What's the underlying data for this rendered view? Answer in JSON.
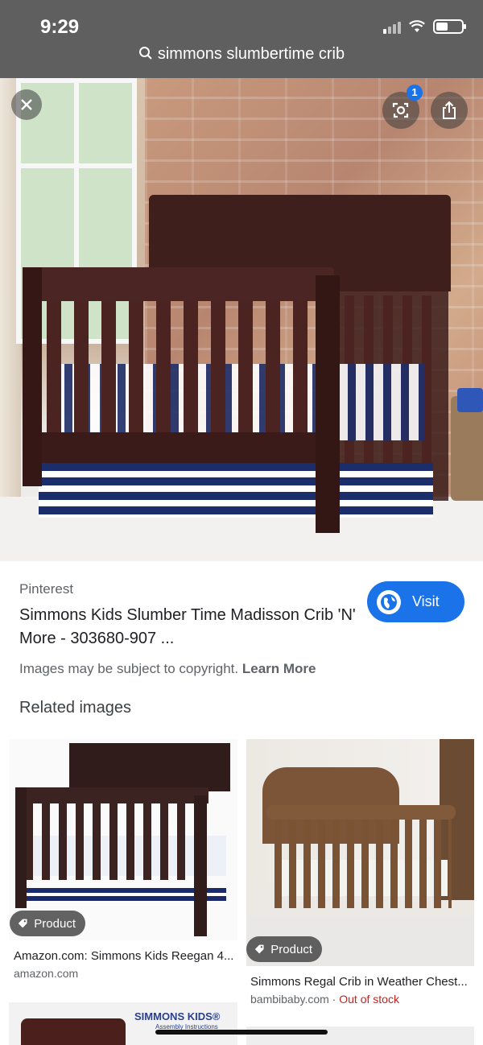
{
  "status_bar": {
    "time": "9:29"
  },
  "search": {
    "query": "simmons slumbertime crib"
  },
  "viewer": {
    "close_icon": "close-icon",
    "lens_badge_count": "1",
    "lens_icon": "google-lens-icon",
    "share_icon": "share-icon"
  },
  "result": {
    "source": "Pinterest",
    "title": "Simmons Kids Slumber Time Madisson Crib 'N' More - 303680-907 ...",
    "visit_label": "Visit",
    "copyright_text": "Images may be subject to copyright.",
    "learn_more_label": "Learn More"
  },
  "related": {
    "heading": "Related images",
    "items": [
      {
        "badge": "Product",
        "title": "Amazon.com: Simmons Kids Reegan 4...",
        "source": "amazon.com"
      },
      {
        "badge": "Product",
        "title": "Simmons Regal Crib in Weather Chest...",
        "source": "bambibaby.com",
        "separator": " · ",
        "stock": "Out of stock"
      },
      {
        "logo_text": "SIMMONS KIDS®",
        "logo_sub": "Assembly Instructions"
      }
    ]
  },
  "colors": {
    "accent": "#1a73e8",
    "out_of_stock": "#c5221f",
    "top_bar": "#5f5f5f"
  }
}
